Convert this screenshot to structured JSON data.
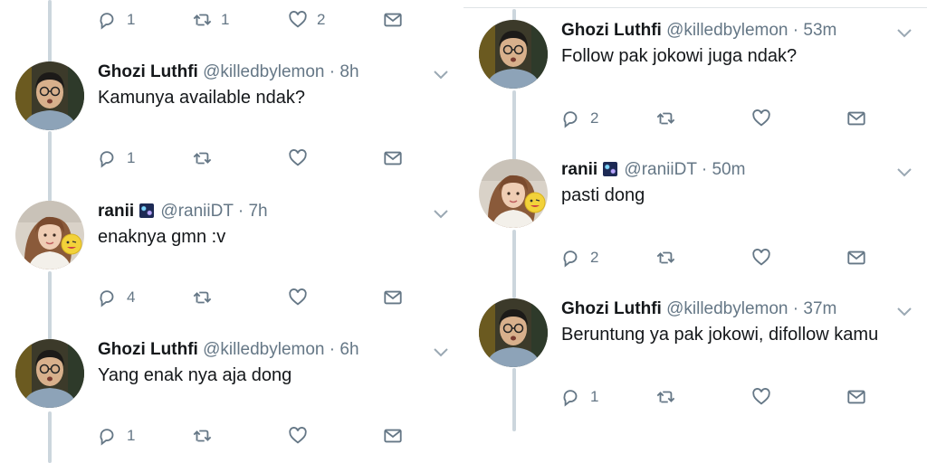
{
  "left": {
    "top_actions": {
      "reply_count": "1",
      "retweet_count": "1",
      "like_count": "2"
    },
    "tweets": [
      {
        "name": "Ghozi Luthfi",
        "handle": "@killedbylemon",
        "dot": "·",
        "time": "8h",
        "text": "Kamunya available ndak?",
        "reply_count": "1",
        "retweet_count": "",
        "like_count": ""
      },
      {
        "name": "ranii",
        "handle": "@raniiDT",
        "dot": "·",
        "time": "7h",
        "text": "enaknya gmn :v",
        "reply_count": "4",
        "retweet_count": "",
        "like_count": ""
      },
      {
        "name": "Ghozi Luthfi",
        "handle": "@killedbylemon",
        "dot": "·",
        "time": "6h",
        "text": "Yang enak nya aja dong",
        "reply_count": "1",
        "retweet_count": "",
        "like_count": ""
      }
    ]
  },
  "right": {
    "tweets": [
      {
        "name": "Ghozi Luthfi",
        "handle": "@killedbylemon",
        "dot": "·",
        "time": "53m",
        "text": "Follow pak jokowi juga ndak?",
        "reply_count": "2",
        "retweet_count": "",
        "like_count": ""
      },
      {
        "name": "ranii",
        "handle": "@raniiDT",
        "dot": "·",
        "time": "50m",
        "text": "pasti dong",
        "reply_count": "2",
        "retweet_count": "",
        "like_count": ""
      },
      {
        "name": "Ghozi Luthfi",
        "handle": "@killedbylemon",
        "dot": "·",
        "time": "37m",
        "text": "Beruntung ya pak jokowi, difollow kamu",
        "reply_count": "1",
        "retweet_count": "",
        "like_count": ""
      }
    ]
  },
  "icons": {
    "reply": "reply-icon",
    "retweet": "retweet-icon",
    "like": "heart-icon",
    "dm": "envelope-icon",
    "more": "chevron-down-icon",
    "flag": "galaxy-emoji-icon"
  },
  "colors": {
    "icon": "#657786",
    "line": "#ccd6dd",
    "text": "#14171a",
    "muted": "#657786"
  }
}
